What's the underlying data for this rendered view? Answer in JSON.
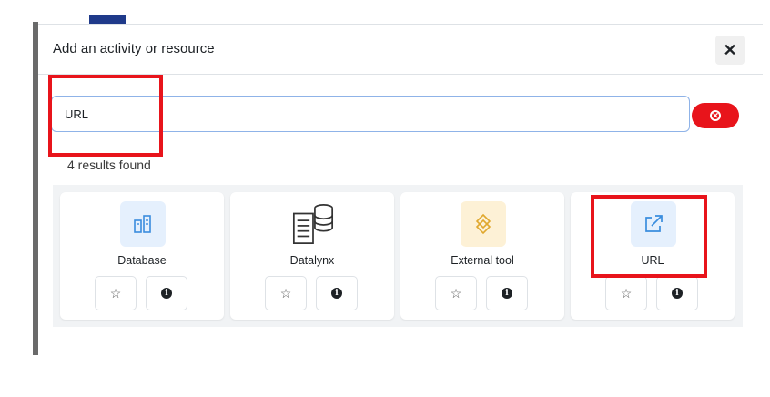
{
  "modal": {
    "title": "Add an activity or resource",
    "close_icon": "close-icon"
  },
  "search": {
    "value": "URL",
    "clear_icon": "clear-search-icon"
  },
  "results": {
    "count_text": "4 results found",
    "items": [
      {
        "name": "Database",
        "icon": "database-icon",
        "icon_bg": "#e5f0fd"
      },
      {
        "name": "Datalynx",
        "icon": "datalynx-icon",
        "icon_bg": "#ffffff"
      },
      {
        "name": "External tool",
        "icon": "external-tool-icon",
        "icon_bg": "#fdf1d6"
      },
      {
        "name": "URL",
        "icon": "external-link-icon",
        "icon_bg": "#e5f0fd"
      }
    ]
  },
  "colors": {
    "accent": "#e8141b",
    "link_blue": "#2b6cb0",
    "icon_blue": "#3a8dde",
    "icon_gold": "#e0a82e"
  }
}
